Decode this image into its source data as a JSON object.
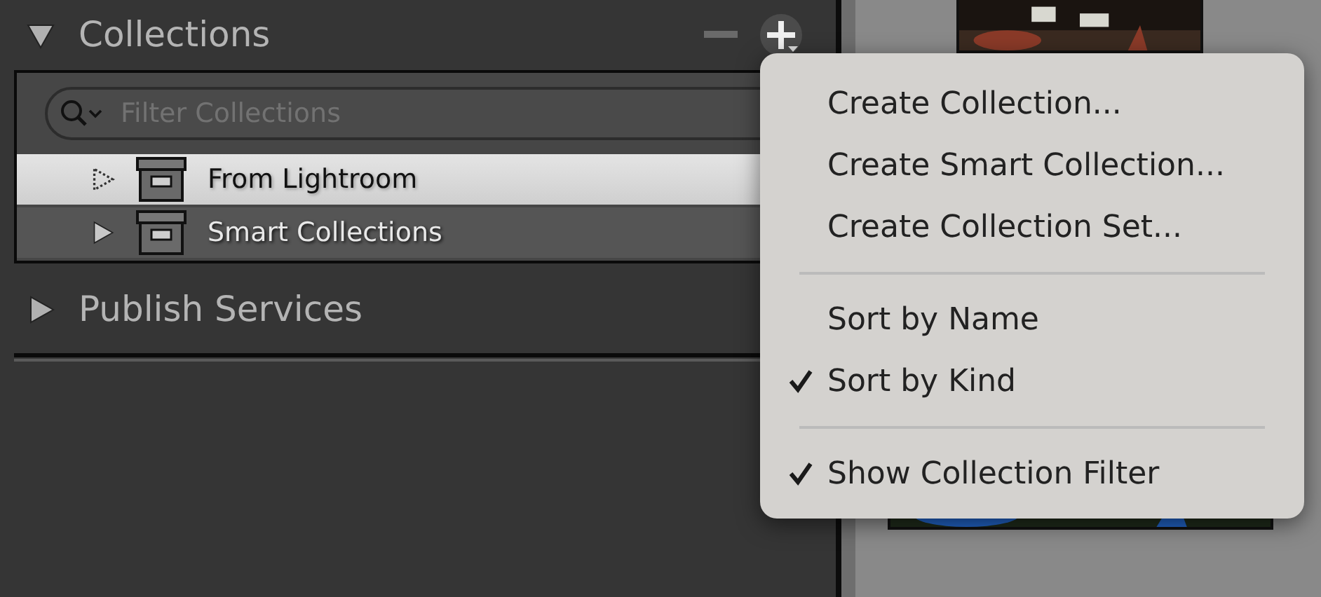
{
  "collections_panel": {
    "title": "Collections",
    "expanded": true,
    "filter": {
      "placeholder": "Filter Collections"
    },
    "items": [
      {
        "label": "From Lightroom",
        "selected": true,
        "empty": true
      },
      {
        "label": "Smart Collections",
        "selected": false,
        "empty": false
      }
    ]
  },
  "publish_services_panel": {
    "title": "Publish Services",
    "expanded": false
  },
  "menu": {
    "sections": [
      {
        "items": [
          {
            "label": "Create Collection...",
            "checked": false
          },
          {
            "label": "Create Smart Collection...",
            "checked": false
          },
          {
            "label": "Create Collection Set...",
            "checked": false
          }
        ]
      },
      {
        "items": [
          {
            "label": "Sort by Name",
            "checked": false
          },
          {
            "label": "Sort by Kind",
            "checked": true
          }
        ]
      },
      {
        "items": [
          {
            "label": "Show Collection Filter",
            "checked": true
          }
        ]
      }
    ]
  }
}
